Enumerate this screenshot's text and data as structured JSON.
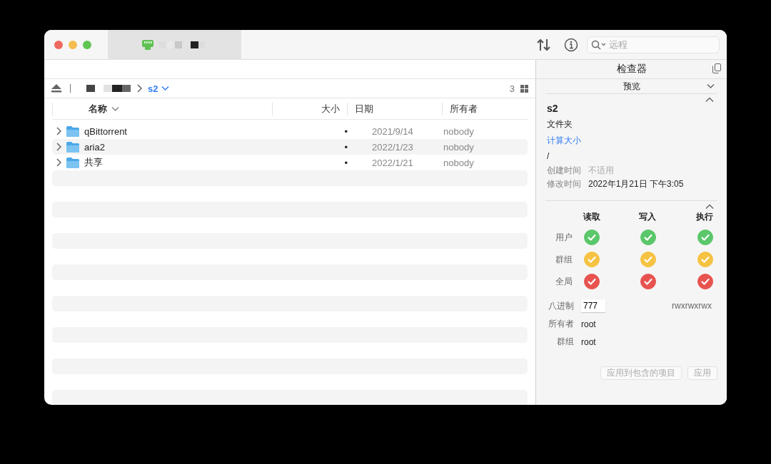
{
  "window": {
    "tab": {
      "selected": true
    },
    "search": {
      "placeholder": "远程"
    }
  },
  "breadcrumb": {
    "current": "s2",
    "count": "3"
  },
  "table": {
    "columns": [
      {
        "label": "名称",
        "sorted": true
      },
      {
        "label": "大小",
        "sorted": false
      },
      {
        "label": "日期",
        "sorted": false
      },
      {
        "label": "所有者",
        "sorted": false
      }
    ],
    "rows": [
      {
        "name": "qBittorrent",
        "size": "•",
        "date": "2021/9/14",
        "owner": "nobody"
      },
      {
        "name": "aria2",
        "size": "•",
        "date": "2022/1/23",
        "owner": "nobody"
      },
      {
        "name": "共享",
        "size": "•",
        "date": "2022/1/21",
        "owner": "nobody"
      }
    ]
  },
  "inspector": {
    "title": "检查器",
    "preview": {
      "label": "预览",
      "expanded": false
    },
    "info": {
      "expanded": true,
      "name": "s2",
      "kind": "文件夹",
      "size_link": "计算大小",
      "path": "/",
      "fields": [
        {
          "label": "创建时间",
          "value": "不适用",
          "available": false
        },
        {
          "label": "修改时间",
          "value": "2022年1月21日 下午3:05",
          "available": true
        }
      ]
    },
    "permissions": {
      "expanded": true,
      "columns": [
        "读取",
        "写入",
        "执行"
      ],
      "rows": [
        {
          "label": "用户",
          "color": "#5ac76a",
          "checks": [
            true,
            true,
            true
          ]
        },
        {
          "label": "群组",
          "color": "#f5c242",
          "checks": [
            true,
            true,
            true
          ]
        },
        {
          "label": "全局",
          "color": "#e8534f",
          "checks": [
            true,
            true,
            true
          ]
        }
      ],
      "octal_label": "八进制",
      "octal": "777",
      "symbolic": "rwxrwxrwx",
      "owner_label": "所有者",
      "owner": "root",
      "group_label": "群组",
      "group": "root"
    },
    "buttons": [
      {
        "label": "应用到包含的项目",
        "disabled": true
      },
      {
        "label": "应用",
        "disabled": true
      }
    ]
  }
}
